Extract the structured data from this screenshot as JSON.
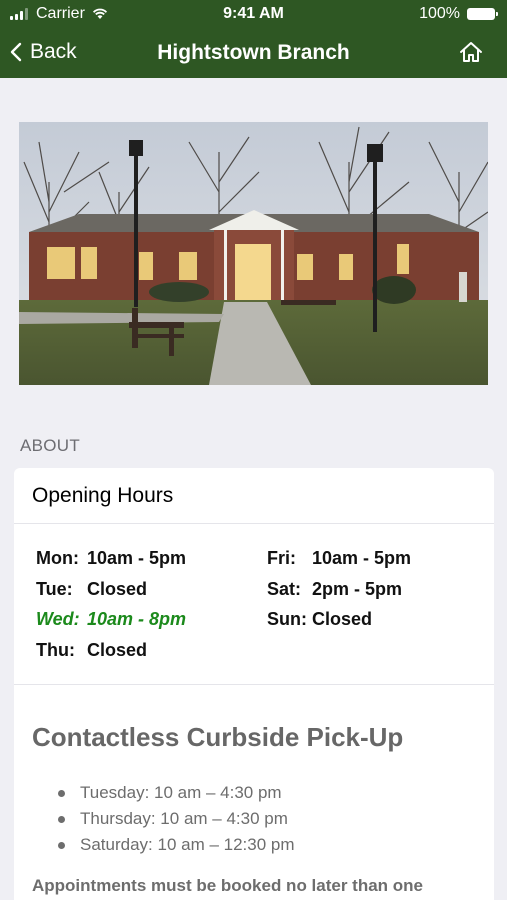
{
  "status_bar": {
    "carrier": "Carrier",
    "time": "9:41 AM",
    "battery": "100%"
  },
  "nav": {
    "back_label": "Back",
    "title": "Hightstown Branch"
  },
  "section_label": "ABOUT",
  "hours_card": {
    "title": "Opening Hours",
    "days": [
      {
        "day": "Mon:",
        "hours": "10am - 5pm",
        "today": false
      },
      {
        "day": "Tue:",
        "hours": "Closed",
        "today": false
      },
      {
        "day": "Wed:",
        "hours": "10am - 8pm",
        "today": true
      },
      {
        "day": "Thu:",
        "hours": "Closed",
        "today": false
      },
      {
        "day": "Fri:",
        "hours": "10am - 5pm",
        "today": false
      },
      {
        "day": "Sat:",
        "hours": "2pm - 5pm",
        "today": false
      },
      {
        "day": "Sun:",
        "hours": "Closed",
        "today": false
      }
    ],
    "highlight_color": "#1c8a1c"
  },
  "curbside": {
    "title": "Contactless Curbside Pick-Up",
    "items": [
      "Tuesday: 10 am – 4:30 pm",
      "Thursday: 10 am – 4:30 pm",
      "Saturday: 10 am – 12:30 pm"
    ],
    "note": "Appointments must be booked no later than one"
  },
  "colors": {
    "brand": "#2e5723",
    "background": "#efeff4"
  }
}
